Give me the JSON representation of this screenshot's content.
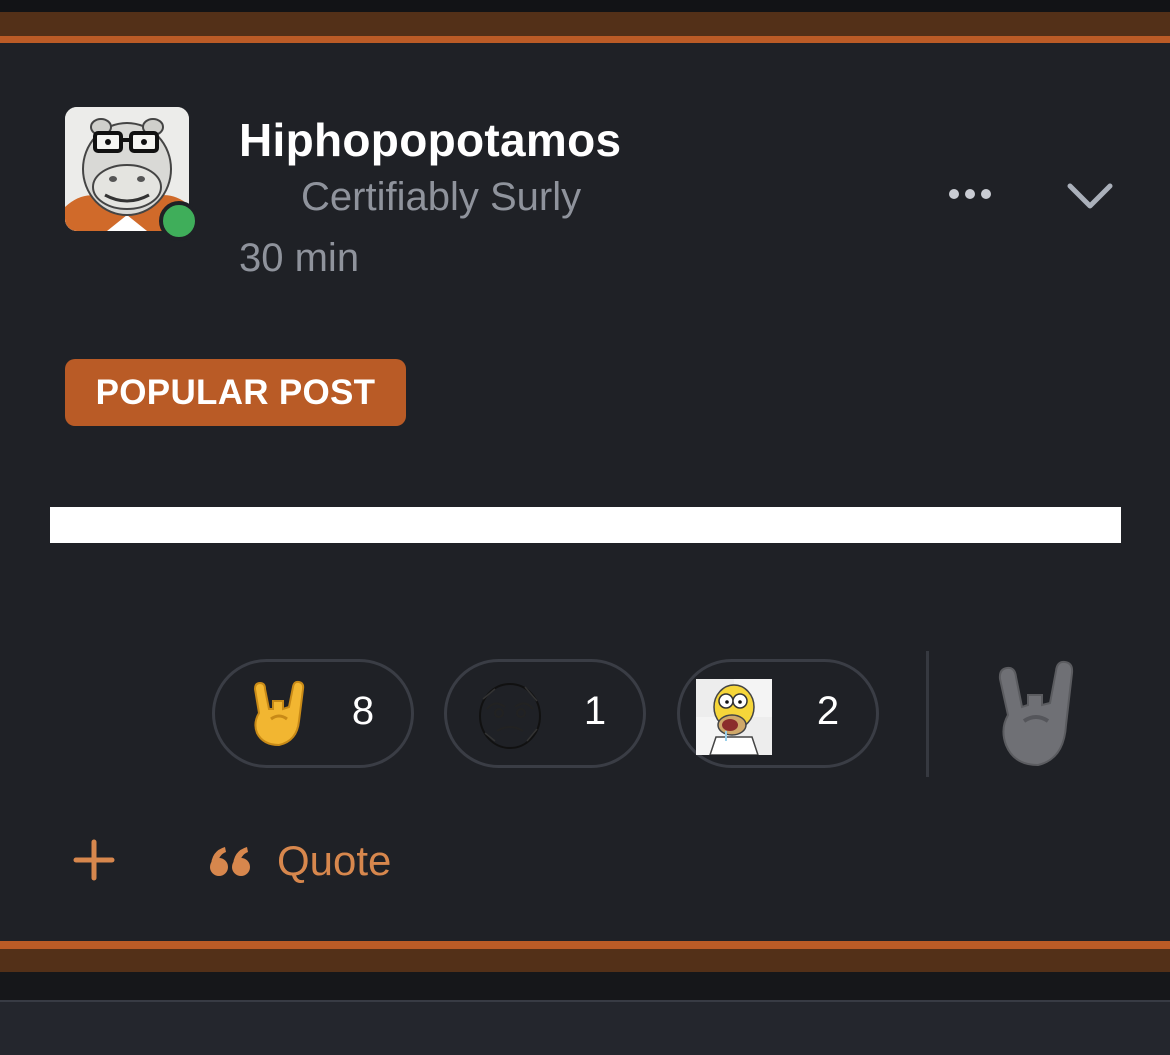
{
  "post": {
    "author": {
      "name": "Hiphopopotamos",
      "title": "Certifiably Surly",
      "online": true,
      "avatar": "hippo-with-glasses-avatar"
    },
    "timestamp": "30 min",
    "badge": "POPULAR POST",
    "header_actions": [
      {
        "icon": "ellipsis-icon"
      },
      {
        "icon": "chevron-down-icon"
      }
    ]
  },
  "reactions": [
    {
      "icon": "rock-on-hand-icon",
      "count": "8"
    },
    {
      "icon": "sketch-face-icon",
      "count": "1"
    },
    {
      "icon": "homer-drool-icon",
      "count": "2"
    }
  ],
  "react_trigger": {
    "icon": "rock-on-hand-gray-icon"
  },
  "footer": {
    "plus_icon": "plus-icon",
    "quote_icon": "quote-icon",
    "quote_label": "Quote"
  },
  "colors": {
    "accent": "#bb5b26",
    "accent_dark": "#533018",
    "background": "#1f2126",
    "muted_text": "#8f939c",
    "online": "#3fae5a",
    "action_text": "#d7874d"
  }
}
